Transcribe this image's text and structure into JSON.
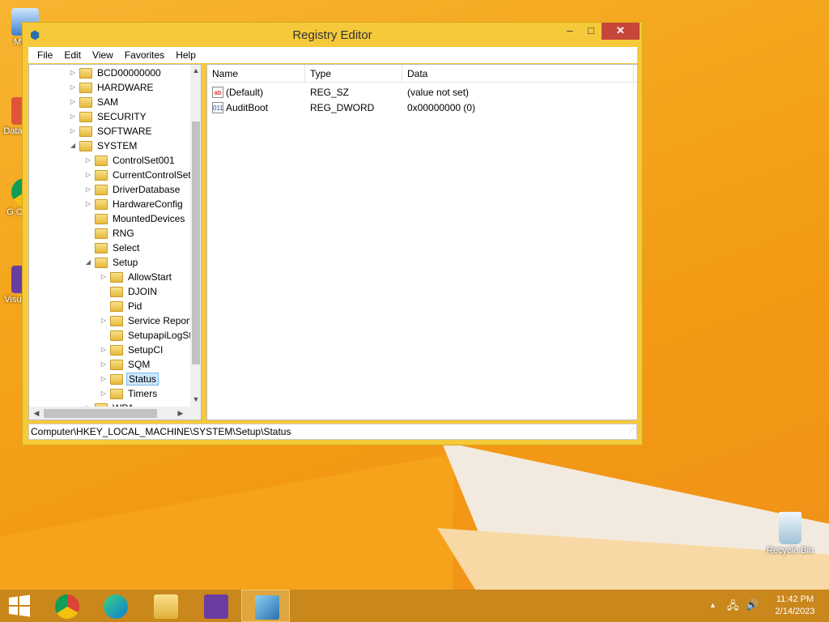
{
  "desktop": {
    "icons": [
      {
        "name": "My C",
        "icon": "computer-icon"
      },
      {
        "name": "Data",
        "icon": "shortcut-icon"
      },
      {
        "name": "G C",
        "icon": "chrome-shortcut-icon"
      },
      {
        "name": "Visu",
        "icon": "visual-studio-icon"
      }
    ],
    "recycle_bin": "Recycle Bin"
  },
  "window": {
    "title": "Registry Editor",
    "controls": {
      "minimize": "–",
      "maximize": "□",
      "close": "✕"
    },
    "menu": [
      "File",
      "Edit",
      "View",
      "Favorites",
      "Help"
    ],
    "tree": [
      {
        "label": "BCD00000000",
        "level": 0,
        "expander": "▷"
      },
      {
        "label": "HARDWARE",
        "level": 0,
        "expander": "▷"
      },
      {
        "label": "SAM",
        "level": 0,
        "expander": "▷"
      },
      {
        "label": "SECURITY",
        "level": 0,
        "expander": "▷"
      },
      {
        "label": "SOFTWARE",
        "level": 0,
        "expander": "▷"
      },
      {
        "label": "SYSTEM",
        "level": 0,
        "expander": "◢"
      },
      {
        "label": "ControlSet001",
        "level": 1,
        "expander": "▷"
      },
      {
        "label": "CurrentControlSet",
        "level": 1,
        "expander": "▷"
      },
      {
        "label": "DriverDatabase",
        "level": 1,
        "expander": "▷"
      },
      {
        "label": "HardwareConfig",
        "level": 1,
        "expander": "▷"
      },
      {
        "label": "MountedDevices",
        "level": 1,
        "expander": ""
      },
      {
        "label": "RNG",
        "level": 1,
        "expander": ""
      },
      {
        "label": "Select",
        "level": 1,
        "expander": ""
      },
      {
        "label": "Setup",
        "level": 1,
        "expander": "◢"
      },
      {
        "label": "AllowStart",
        "level": 2,
        "expander": "▷"
      },
      {
        "label": "DJOIN",
        "level": 2,
        "expander": ""
      },
      {
        "label": "Pid",
        "level": 2,
        "expander": ""
      },
      {
        "label": "Service Report",
        "level": 2,
        "expander": "▷"
      },
      {
        "label": "SetupapiLogSt",
        "level": 2,
        "expander": ""
      },
      {
        "label": "SetupCI",
        "level": 2,
        "expander": "▷"
      },
      {
        "label": "SQM",
        "level": 2,
        "expander": "▷"
      },
      {
        "label": "Status",
        "level": 2,
        "expander": "▷",
        "selected": true
      },
      {
        "label": "Timers",
        "level": 2,
        "expander": "▷"
      },
      {
        "label": "WPA",
        "level": 1,
        "expander": "▷"
      }
    ],
    "columns": [
      "Name",
      "Type",
      "Data"
    ],
    "values": [
      {
        "name": "(Default)",
        "type": "REG_SZ",
        "data": "(value not set)",
        "icon": "ab"
      },
      {
        "name": "AuditBoot",
        "type": "REG_DWORD",
        "data": "0x00000000 (0)",
        "icon": "011"
      }
    ],
    "status_path": "Computer\\HKEY_LOCAL_MACHINE\\SYSTEM\\Setup\\Status"
  },
  "taskbar": {
    "start_icon": "windows-logo-icon",
    "apps": [
      "chrome-icon",
      "edge-icon",
      "file-explorer-icon",
      "visual-studio-icon",
      "registry-editor-icon"
    ],
    "tray": {
      "chevron": "▲",
      "network": "network-icon",
      "volume": "volume-icon"
    },
    "time": "11:42 PM",
    "date": "2/14/2023"
  }
}
